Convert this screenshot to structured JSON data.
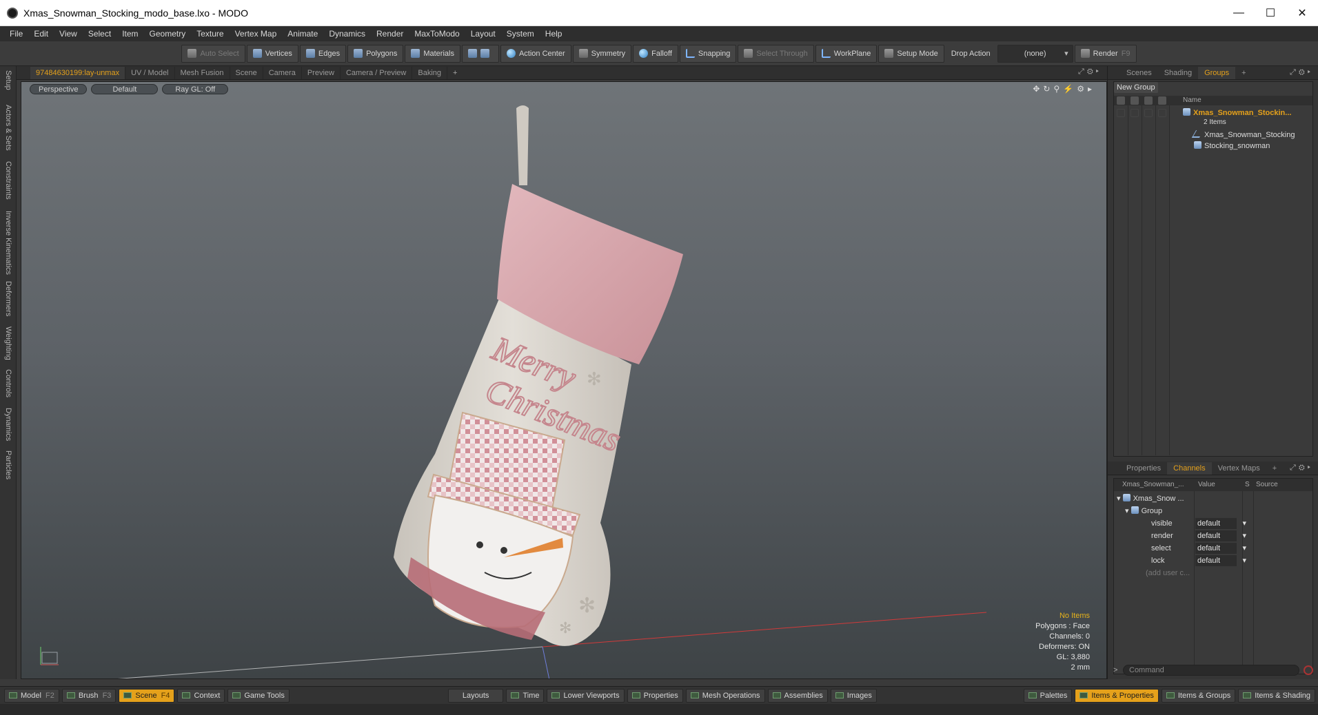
{
  "window": {
    "title": "Xmas_Snowman_Stocking_modo_base.lxo - MODO",
    "minimize": "—",
    "maximize": "☐",
    "close": "✕"
  },
  "menu": [
    "File",
    "Edit",
    "View",
    "Select",
    "Item",
    "Geometry",
    "Texture",
    "Vertex Map",
    "Animate",
    "Dynamics",
    "Render",
    "MaxToModo",
    "Layout",
    "System",
    "Help"
  ],
  "toolbar": {
    "auto_select": "Auto Select",
    "vertices": "Vertices",
    "edges": "Edges",
    "polygons": "Polygons",
    "materials": "Materials",
    "action_center": "Action Center",
    "symmetry": "Symmetry",
    "falloff": "Falloff",
    "snapping": "Snapping",
    "select_through": "Select Through",
    "workplane": "WorkPlane",
    "setup_mode": "Setup Mode",
    "drop_action_label": "Drop Action",
    "drop_action_value": "(none)",
    "render": "Render",
    "render_key": "F9"
  },
  "left_tabs": [
    "Setup",
    "Actors & Sets",
    "Constraints",
    "Inverse Kinematics",
    "Deformers",
    "Weighting",
    "Controls",
    "Dynamics",
    "Particles"
  ],
  "viewport_tabs": [
    "97484630199:lay-unmax",
    "UV / Model",
    "Mesh Fusion",
    "Scene",
    "Camera",
    "Preview",
    "Camera / Preview",
    "Baking",
    "+"
  ],
  "viewport": {
    "view": "Perspective",
    "shading": "Default",
    "raygl": "Ray GL: Off",
    "stats": {
      "items": "No Items",
      "polygons": "Polygons : Face",
      "channels": "Channels: 0",
      "deformers": "Deformers: ON",
      "gl": "GL: 3,880",
      "scale": "2 mm"
    }
  },
  "scene_panel": {
    "tabs": [
      "Scenes",
      "Shading",
      "Groups",
      "+"
    ],
    "new_group": "New Group",
    "col_name": "Name",
    "group_name": "Xmas_Snowman_Stockin...",
    "group_count": "2 Items",
    "children": [
      "Xmas_Snowman_Stocking",
      "Stocking_snowman"
    ]
  },
  "channels_panel": {
    "tabs": [
      "Properties",
      "Channels",
      "Vertex Maps",
      "+"
    ],
    "headers": {
      "name": "Xmas_Snowman_...",
      "value": "Value",
      "s": "S",
      "source": "Source"
    },
    "root": "Xmas_Snow ...",
    "group": "Group",
    "rows": [
      {
        "name": "visible",
        "value": "default"
      },
      {
        "name": "render",
        "value": "default"
      },
      {
        "name": "select",
        "value": "default"
      },
      {
        "name": "lock",
        "value": "default"
      }
    ],
    "add_user": "(add user c...",
    "command_placeholder": "Command",
    "prompt": ">"
  },
  "bottombar": {
    "model": "Model",
    "model_key": "F2",
    "brush": "Brush",
    "brush_key": "F3",
    "scene": "Scene",
    "scene_key": "F4",
    "context": "Context",
    "game_tools": "Game Tools",
    "layouts": "Layouts",
    "time": "Time",
    "lower_viewports": "Lower Viewports",
    "properties": "Properties",
    "mesh_operations": "Mesh Operations",
    "assemblies": "Assemblies",
    "images": "Images",
    "palettes": "Palettes",
    "items_properties": "Items & Properties",
    "items_groups": "Items & Groups",
    "items_shading": "Items & Shading"
  },
  "stocking_text": [
    "Merry",
    "Christmas"
  ],
  "colors": {
    "accent": "#e5a11b",
    "cuff": "#d9a6ac",
    "stocking": "#d8d4cc"
  }
}
